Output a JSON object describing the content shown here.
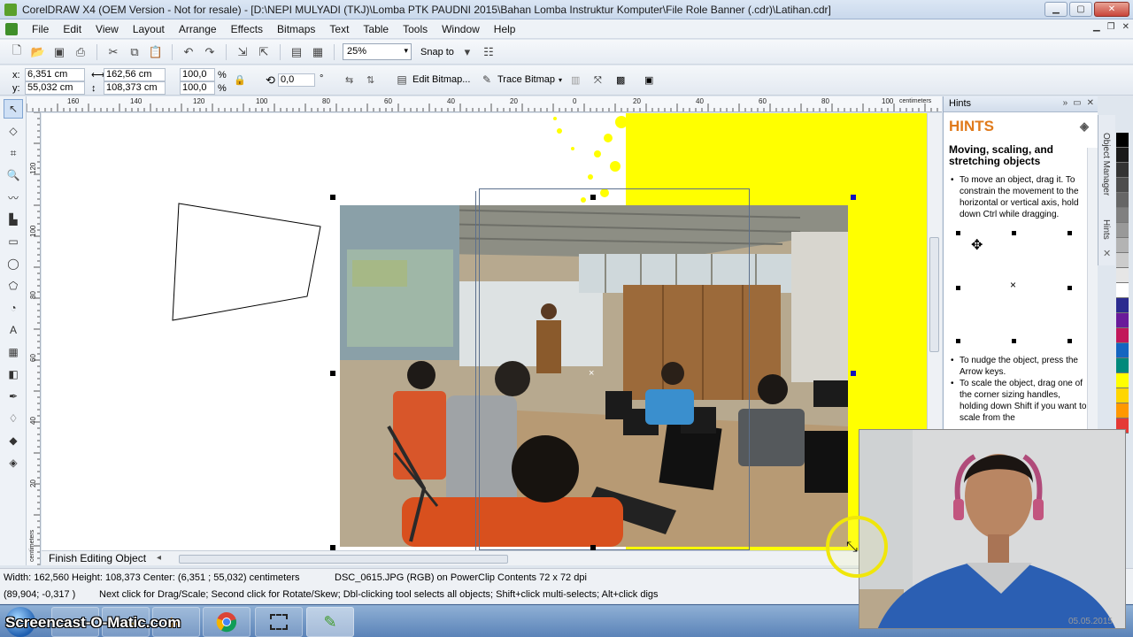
{
  "window": {
    "title": "CorelDRAW X4 (OEM Version - Not for resale) - [D:\\NEPI MULYADI (TKJ)\\Lomba PTK PAUDNI 2015\\Bahan Lomba Instruktur Komputer\\File Role Banner (.cdr)\\Latihan.cdr]"
  },
  "menu": {
    "items": [
      "File",
      "Edit",
      "View",
      "Layout",
      "Arrange",
      "Effects",
      "Bitmaps",
      "Text",
      "Table",
      "Tools",
      "Window",
      "Help"
    ]
  },
  "toolbar": {
    "zoom_value": "25%",
    "snap_label": "Snap to"
  },
  "property_bar": {
    "x_label": "x:",
    "x_value": "6,351 cm",
    "y_label": "y:",
    "y_value": "55,032 cm",
    "width_value": "162,56 cm",
    "height_value": "108,373 cm",
    "scale_x": "100,0",
    "scale_y": "100,0",
    "percent": "%",
    "rotation": "0,0",
    "degree": "°",
    "edit_bitmap_label": "Edit Bitmap...",
    "trace_bitmap_label": "Trace Bitmap"
  },
  "ruler": {
    "top_labels": [
      "160",
      "140",
      "120",
      "100",
      "80",
      "60",
      "40",
      "20",
      "0",
      "20",
      "40",
      "60",
      "80",
      "100"
    ],
    "unit": "centimeters",
    "left_labels": [
      "120",
      "100",
      "80",
      "60",
      "40",
      "20"
    ],
    "left_unit": "centimeters"
  },
  "canvas": {
    "finish_tab_label": "Finish Editing Object"
  },
  "hints": {
    "panel_title": "Hints",
    "heading": "HINTS",
    "subtitle": "Moving, scaling, and stretching objects",
    "bullets_top": [
      "To move an object, drag it. To constrain the movement to the horizontal or vertical axis, hold down Ctrl while dragging."
    ],
    "bullets_bottom": [
      "To nudge the object, press the Arrow keys.",
      "To scale the object, drag one of the corner sizing handles, holding down Shift if you want to scale from the"
    ]
  },
  "side_tabs": {
    "object_manager": "Object Manager",
    "hints": "Hints"
  },
  "palette": {
    "colors": [
      "#000000",
      "#1a1a1a",
      "#333333",
      "#4d4d4d",
      "#666666",
      "#808080",
      "#999999",
      "#b3b3b3",
      "#cccccc",
      "#e6e6e6",
      "#ffffff",
      "#2b2b8f",
      "#6a1b9a",
      "#c2185b",
      "#1565c0",
      "#00897b",
      "#ffff00",
      "#ffd600",
      "#ff9800",
      "#e53935"
    ]
  },
  "status": {
    "line1_left": "Width: 162,560  Height: 108,373  Center: (6,351 ; 55,032)  centimeters",
    "line1_right": "DSC_0615.JPG (RGB) on PowerClip Contents 72 x 72 dpi",
    "line2_coords": "(89,904; -0,317 )",
    "line2_message": "Next click for Drag/Scale; Second click for Rotate/Skew; Dbl-clicking tool selects all objects; Shift+click multi-selects; Alt+click digs"
  },
  "taskbar": {
    "watermark": "Screencast-O-Matic.com"
  },
  "webcam": {
    "timestamp": "05.05.2015"
  }
}
